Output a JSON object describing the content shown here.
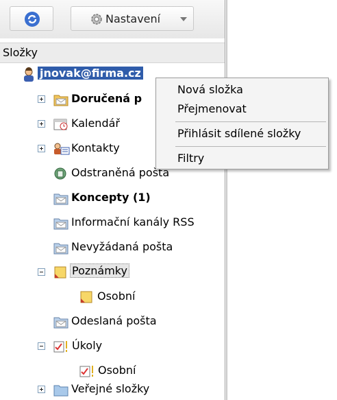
{
  "toolbar": {
    "settings_label": "Nastavení",
    "refresh_icon": "refresh-icon",
    "settings_icon": "gear-icon"
  },
  "folders": {
    "header": "Složky",
    "account": "jnovak@firma.cz",
    "items": [
      {
        "label": "Doručená p",
        "icon": "inbox-folder-icon"
      },
      {
        "label": "Kalendář",
        "icon": "calendar-icon"
      },
      {
        "label": "Kontakty",
        "icon": "contacts-icon"
      },
      {
        "label": "Odstraněná pošta",
        "icon": "trash-icon"
      },
      {
        "label": "Koncepty (1)",
        "icon": "drafts-folder-icon"
      },
      {
        "label": "Informační kanály RSS",
        "icon": "rss-folder-icon"
      },
      {
        "label": "Nevyžádaná pošta",
        "icon": "junk-folder-icon"
      },
      {
        "label": "Poznámky",
        "icon": "notes-icon"
      },
      {
        "label": "Osobní",
        "icon": "notes-icon"
      },
      {
        "label": "Odeslaná pošta",
        "icon": "sent-folder-icon"
      },
      {
        "label": "Úkoly",
        "icon": "tasks-icon"
      },
      {
        "label": "Osobní",
        "icon": "tasks-icon"
      },
      {
        "label": "Veřejné složky",
        "icon": "public-folder-icon"
      }
    ]
  },
  "context_menu": {
    "items": [
      "Nová složka",
      "Přejmenovat",
      "Přihlásit sdílené složky",
      "Filtry"
    ]
  },
  "colors": {
    "selection": "#2f5caa",
    "folder": "#f2c55c"
  }
}
